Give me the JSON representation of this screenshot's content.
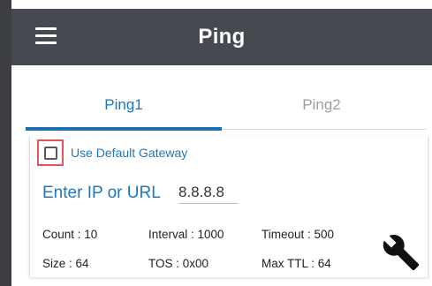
{
  "appbar": {
    "title": "Ping",
    "menu_icon": "hamburger-menu-icon"
  },
  "tabs": [
    {
      "label": "Ping1",
      "active": true
    },
    {
      "label": "Ping2",
      "active": false
    }
  ],
  "card": {
    "checkbox": {
      "label": "Use Default Gateway",
      "checked": false
    },
    "target": {
      "label": "Enter IP or URL",
      "value": "8.8.8.8"
    },
    "params": {
      "count": "Count : 10",
      "interval": "Interval : 1000",
      "timeout": "Timeout : 500",
      "size": "Size : 64",
      "tos": "TOS : 0x00",
      "max_ttl": "Max TTL : 64"
    },
    "settings_icon": "wrench-icon"
  },
  "colors": {
    "appbar": "#464950",
    "accent": "#1f77bd",
    "tab_indicator": "#1b6fb0",
    "highlight_border": "#e25656"
  }
}
